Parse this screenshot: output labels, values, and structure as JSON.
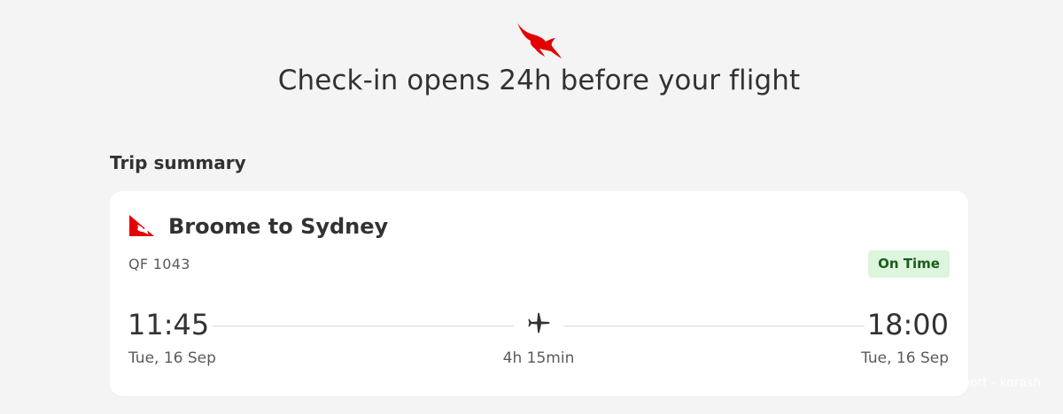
{
  "headline": "Check-in opens 24h before your flight",
  "trip_summary": {
    "title": "Trip summary",
    "route": "Broome to Sydney",
    "flight_number": "QF 1043",
    "status": "On Time",
    "departure": {
      "time": "11:45",
      "date": "Tue, 16 Sep"
    },
    "arrival": {
      "time": "18:00",
      "date": "Tue, 16 Sep"
    },
    "duration": "4h 15min"
  },
  "watermark": "port - korash",
  "icons": {
    "top_logo": "qantas-kangaroo-icon",
    "card_logo": "qantas-tail-icon",
    "plane": "airplane-icon"
  },
  "colors": {
    "brand_red": "#e40000",
    "status_bg": "#dcf5dc",
    "status_text": "#1e5a1e",
    "page_bg": "#f4f4f4"
  }
}
